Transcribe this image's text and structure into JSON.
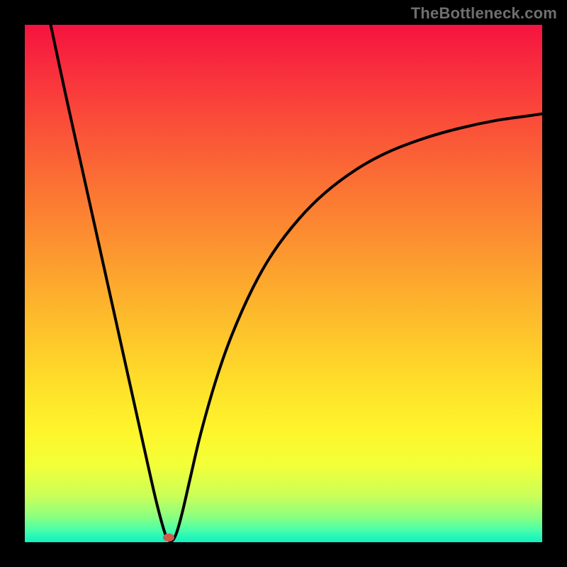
{
  "watermark": "TheBottleneck.com",
  "chart_data": {
    "type": "line",
    "title": "",
    "xlabel": "",
    "ylabel": "",
    "xlim": [
      0,
      100
    ],
    "ylim": [
      0,
      100
    ],
    "grid": false,
    "legend": false,
    "gradient_stops": [
      {
        "pos": 0.0,
        "color": "#f5133f"
      },
      {
        "pos": 0.08,
        "color": "#f82c3d"
      },
      {
        "pos": 0.18,
        "color": "#fa4b39"
      },
      {
        "pos": 0.3,
        "color": "#fb6f34"
      },
      {
        "pos": 0.42,
        "color": "#fc9130"
      },
      {
        "pos": 0.55,
        "color": "#fdb72c"
      },
      {
        "pos": 0.68,
        "color": "#fedb2a"
      },
      {
        "pos": 0.78,
        "color": "#fff42b"
      },
      {
        "pos": 0.85,
        "color": "#f3ff37"
      },
      {
        "pos": 0.91,
        "color": "#cbff58"
      },
      {
        "pos": 0.95,
        "color": "#8dff7f"
      },
      {
        "pos": 0.975,
        "color": "#4cffa8"
      },
      {
        "pos": 1.0,
        "color": "#0df1c3"
      }
    ],
    "curve_points": [
      {
        "x": 5.0,
        "y": 100.0
      },
      {
        "x": 8.0,
        "y": 86.0
      },
      {
        "x": 11.0,
        "y": 72.5
      },
      {
        "x": 14.0,
        "y": 59.0
      },
      {
        "x": 17.0,
        "y": 45.5
      },
      {
        "x": 20.0,
        "y": 32.0
      },
      {
        "x": 22.0,
        "y": 23.0
      },
      {
        "x": 24.0,
        "y": 14.0
      },
      {
        "x": 25.5,
        "y": 7.5
      },
      {
        "x": 27.0,
        "y": 2.0
      },
      {
        "x": 27.8,
        "y": 0.4
      },
      {
        "x": 28.6,
        "y": 0.4
      },
      {
        "x": 29.4,
        "y": 2.0
      },
      {
        "x": 30.5,
        "y": 6.0
      },
      {
        "x": 32.0,
        "y": 12.5
      },
      {
        "x": 34.0,
        "y": 21.0
      },
      {
        "x": 37.0,
        "y": 31.5
      },
      {
        "x": 40.0,
        "y": 40.0
      },
      {
        "x": 44.0,
        "y": 49.0
      },
      {
        "x": 48.0,
        "y": 56.0
      },
      {
        "x": 53.0,
        "y": 62.5
      },
      {
        "x": 58.0,
        "y": 67.5
      },
      {
        "x": 64.0,
        "y": 72.0
      },
      {
        "x": 70.0,
        "y": 75.3
      },
      {
        "x": 77.0,
        "y": 78.0
      },
      {
        "x": 84.0,
        "y": 80.0
      },
      {
        "x": 91.0,
        "y": 81.5
      },
      {
        "x": 98.0,
        "y": 82.5
      },
      {
        "x": 100.0,
        "y": 82.8
      }
    ],
    "marker": {
      "x": 27.8,
      "y": 0.9,
      "r": 1.1,
      "color": "#d0594f"
    }
  }
}
